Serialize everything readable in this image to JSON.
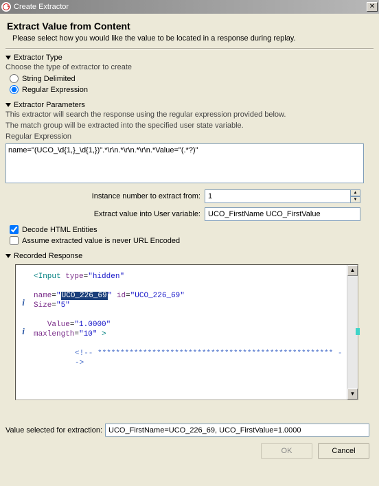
{
  "window": {
    "title": "Create Extractor"
  },
  "header": {
    "title": "Extract Value from Content",
    "subtitle": "Please select how you would like the value to be located in a response during replay."
  },
  "extractor_type": {
    "section_label": "Extractor Type",
    "desc": "Choose the type of extractor to create",
    "options": {
      "string_delimited": "String Delimited",
      "regex": "Regular Expression"
    },
    "selected": "regex"
  },
  "params": {
    "section_label": "Extractor Parameters",
    "desc1": "This extractor will search the response using the regular expression provided below.",
    "desc2": "The match group will be extracted into the specified user state variable.",
    "regex_label": "Regular Expression",
    "regex_value": "name=\"(UCO_\\d{1,}_\\d{1,})\".*\\r\\n.*\\r\\n.*\\r\\n.*Value=\"(.*?)\"",
    "instance_label": "Instance number to extract from:",
    "instance_value": "1",
    "uservar_label": "Extract value into User variable:",
    "uservar_value": "UCO_FirstName UCO_FirstValue",
    "decode_label": "Decode HTML Entities",
    "decode_checked": true,
    "assume_label": "Assume extracted value is never URL Encoded",
    "assume_checked": false
  },
  "recorded": {
    "section_label": "Recorded Response",
    "code": {
      "line1_tag": "<Input",
      "line1_attr": " type",
      "line1_eq": "=",
      "line1_val": "\"hidden\"",
      "line3_attr1": "name",
      "line3_eq": "=",
      "line3_q1": "\"",
      "line3_sel": "UCO_226_69",
      "line3_q2": "\"",
      "line3_attr2": " id",
      "line3_val2": "\"UCO_226_69\"",
      "line4_attr": "Size",
      "line4_val": "\"5\"",
      "line6_attr": "Value",
      "line6_val": "\"1.0000\"",
      "line7_attr": "maxlength",
      "line7_val": "\"10\"",
      "line7_end": "  >",
      "comment": "<!--  **************************************************** -->"
    }
  },
  "selection": {
    "label": "Value selected for extraction:",
    "value": "UCO_FirstName=UCO_226_69, UCO_FirstValue=1.0000"
  },
  "buttons": {
    "ok": "OK",
    "cancel": "Cancel"
  }
}
